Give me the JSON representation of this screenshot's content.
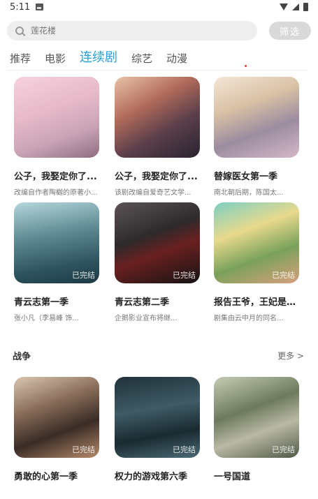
{
  "status": {
    "time": "5:11"
  },
  "search": {
    "placeholder": "莲花楼",
    "filter_label": "筛选"
  },
  "tabs": [
    {
      "label": "推荐"
    },
    {
      "label": "电影"
    },
    {
      "label": "连续剧"
    },
    {
      "label": "综艺"
    },
    {
      "label": "动漫"
    }
  ],
  "rows": [
    [
      {
        "title": "公子，我娶定你了...",
        "subtitle": "改编自作者陶樾的原著小..."
      },
      {
        "title": "公子，我娶定你了...",
        "subtitle": "该剧改编自爱奇艺文学..."
      },
      {
        "title": "替嫁医女第一季",
        "subtitle": "南北朝后期，陈国太..."
      }
    ],
    [
      {
        "title": "青云志第一季",
        "subtitle": "张小凡（李易峰 饰...",
        "badge": "已完结"
      },
      {
        "title": "青云志第二季",
        "subtitle": "企鹅影业宣布将继...",
        "badge": "已完结"
      },
      {
        "title": "报告王爷，王妃是只...",
        "subtitle": "剧集由云中月的同名...",
        "badge": "已完结"
      }
    ]
  ],
  "war_section": {
    "title": "战争",
    "more": "更多 >",
    "items": [
      {
        "title": "勇敢的心第一季",
        "badge": "已完结"
      },
      {
        "title": "权力的游戏第六季",
        "badge": "已完结"
      },
      {
        "title": "一号国道",
        "badge": "已完结"
      }
    ]
  },
  "colors": {
    "accent": "#2a9fd8",
    "filter_bg": "#d9d9d9"
  }
}
